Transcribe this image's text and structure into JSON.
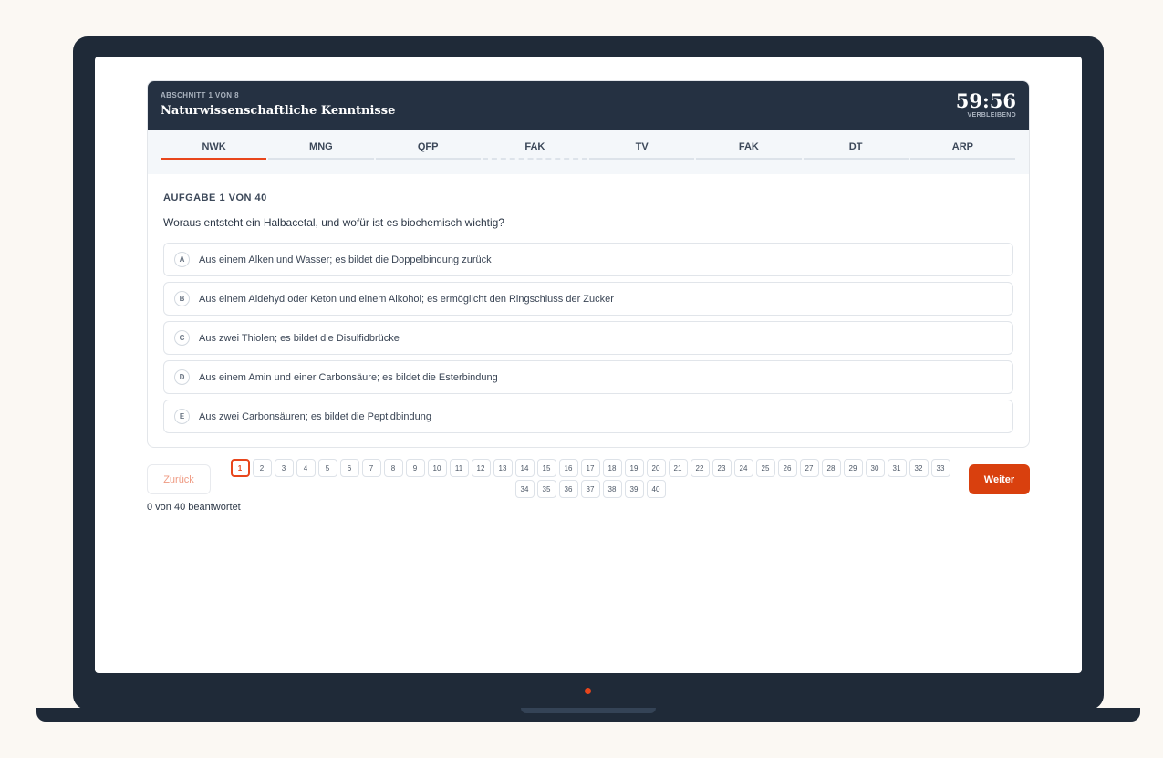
{
  "header": {
    "section_kicker": "ABSCHNITT 1 VON 8",
    "section_title": "Naturwissenschaftliche Kenntnisse",
    "timer": "59:56",
    "timer_label": "VERBLEIBEND"
  },
  "tabs": [
    {
      "label": "NWK",
      "state": "active"
    },
    {
      "label": "MNG",
      "state": "normal"
    },
    {
      "label": "QFP",
      "state": "normal"
    },
    {
      "label": "FAK",
      "state": "dashed"
    },
    {
      "label": "TV",
      "state": "normal"
    },
    {
      "label": "FAK",
      "state": "normal"
    },
    {
      "label": "DT",
      "state": "normal"
    },
    {
      "label": "ARP",
      "state": "normal"
    }
  ],
  "question": {
    "number_label": "AUFGABE 1 VON 40",
    "text": "Woraus entsteht ein Halbacetal, und wofür ist es biochemisch wichtig?",
    "options": [
      {
        "letter": "A",
        "text": "Aus einem Alken und Wasser; es bildet die Doppelbindung zurück"
      },
      {
        "letter": "B",
        "text": "Aus einem Aldehyd oder Keton und einem Alkohol; es ermöglicht den Ringschluss der Zucker"
      },
      {
        "letter": "C",
        "text": "Aus zwei Thiolen; es bildet die Disulfidbrücke"
      },
      {
        "letter": "D",
        "text": "Aus einem Amin und einer Carbonsäure; es bildet die Esterbindung"
      },
      {
        "letter": "E",
        "text": "Aus zwei Carbonsäuren; es bildet die Peptidbindung"
      }
    ]
  },
  "nav": {
    "back_label": "Zurück",
    "next_label": "Weiter",
    "answered_label": "0 von 40 beantwortet",
    "current_page": 1,
    "pages": [
      "1",
      "2",
      "3",
      "4",
      "5",
      "6",
      "7",
      "8",
      "9",
      "10",
      "11",
      "12",
      "13",
      "14",
      "15",
      "16",
      "17",
      "18",
      "19",
      "20",
      "21",
      "22",
      "23",
      "24",
      "25",
      "26",
      "27",
      "28",
      "29",
      "30",
      "31",
      "32",
      "33",
      "34",
      "35",
      "36",
      "37",
      "38",
      "39",
      "40"
    ]
  },
  "colors": {
    "accent": "#e8461c",
    "header_bg": "#253142",
    "device": "#1f2a38"
  }
}
